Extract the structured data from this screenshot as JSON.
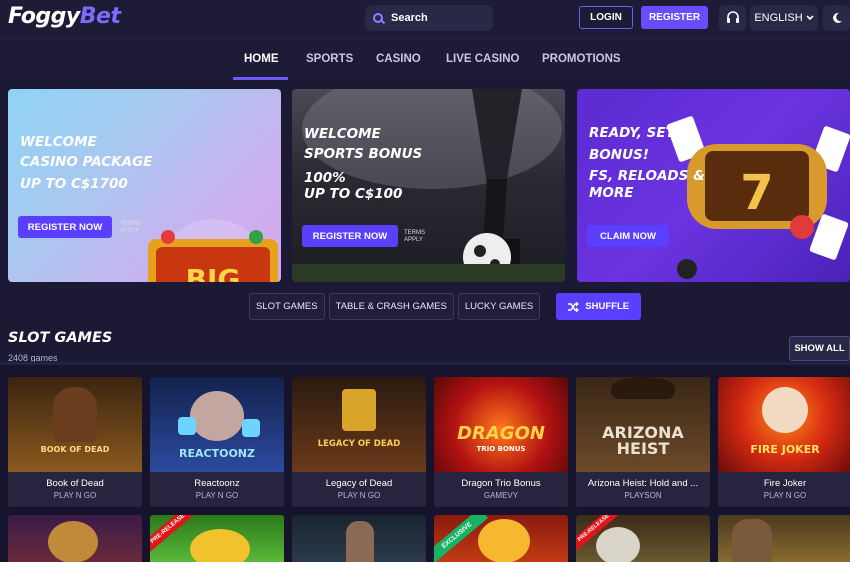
{
  "header": {
    "logo_part1": "Foggy",
    "logo_part2": "Bet",
    "search_placeholder": "Search",
    "login_label": "LOGIN",
    "register_label": "REGISTER",
    "support_icon": "headset-icon",
    "language": "ENGLISH",
    "theme_icon": "moon-icon"
  },
  "nav": {
    "items": [
      {
        "label": "HOME",
        "active": true
      },
      {
        "label": "SPORTS",
        "active": false
      },
      {
        "label": "CASINO",
        "active": false
      },
      {
        "label": "LIVE CASINO",
        "active": false
      },
      {
        "label": "PROMOTIONS",
        "active": false
      }
    ]
  },
  "banners": [
    {
      "line1": "Welcome",
      "line2": "Casino Package",
      "line3": "Up to C$1700",
      "line4": "",
      "cta": "REGISTER NOW",
      "terms": "TERMS APPLY"
    },
    {
      "line1": "Welcome",
      "line2": "Sports Bonus",
      "line3": "100%",
      "line4": "Up to C$100",
      "cta": "REGISTER NOW",
      "terms": "TERMS APPLY"
    },
    {
      "line1": "Ready, Set,",
      "line2": "Bonus!",
      "line3": "FS, Reloads &",
      "line4": "More",
      "cta": "CLAIM NOW",
      "terms": ""
    }
  ],
  "filters": [
    "SLOT GAMES",
    "TABLE & CRASH GAMES",
    "LUCKY GAMES"
  ],
  "shuffle_label": "SHUFFLE",
  "section": {
    "title": "SLOT GAMES",
    "count": "2408 games",
    "show_all": "SHOW ALL"
  },
  "games": [
    {
      "name": "Book of Dead",
      "provider": "PLAY N GO",
      "art_text": "BOOK OF DEAD",
      "color": "#8a5a1e"
    },
    {
      "name": "Reactoonz",
      "provider": "PLAY N GO",
      "art_text": "REACTOONZ",
      "color": "#1a3a7a"
    },
    {
      "name": "Legacy of Dead",
      "provider": "PLAY N GO",
      "art_text": "LEGACY OF DEAD",
      "color": "#6a3a1a"
    },
    {
      "name": "Dragon Trio Bonus",
      "provider": "GAMEVY",
      "art_text": "DRAGON",
      "color": "#8a1010"
    },
    {
      "name": "Arizona Heist: Hold and ...",
      "provider": "PLAYSON",
      "art_text": "ARIZONA HEIST",
      "color": "#5a3a22"
    },
    {
      "name": "Fire Joker",
      "provider": "PLAY N GO",
      "art_text": "FIRE JOKER",
      "color": "#a5101a"
    }
  ],
  "second_row_badges": [
    "PRE-RELEASE",
    "EXCLUSIVE",
    "PRE-RELEASE"
  ]
}
